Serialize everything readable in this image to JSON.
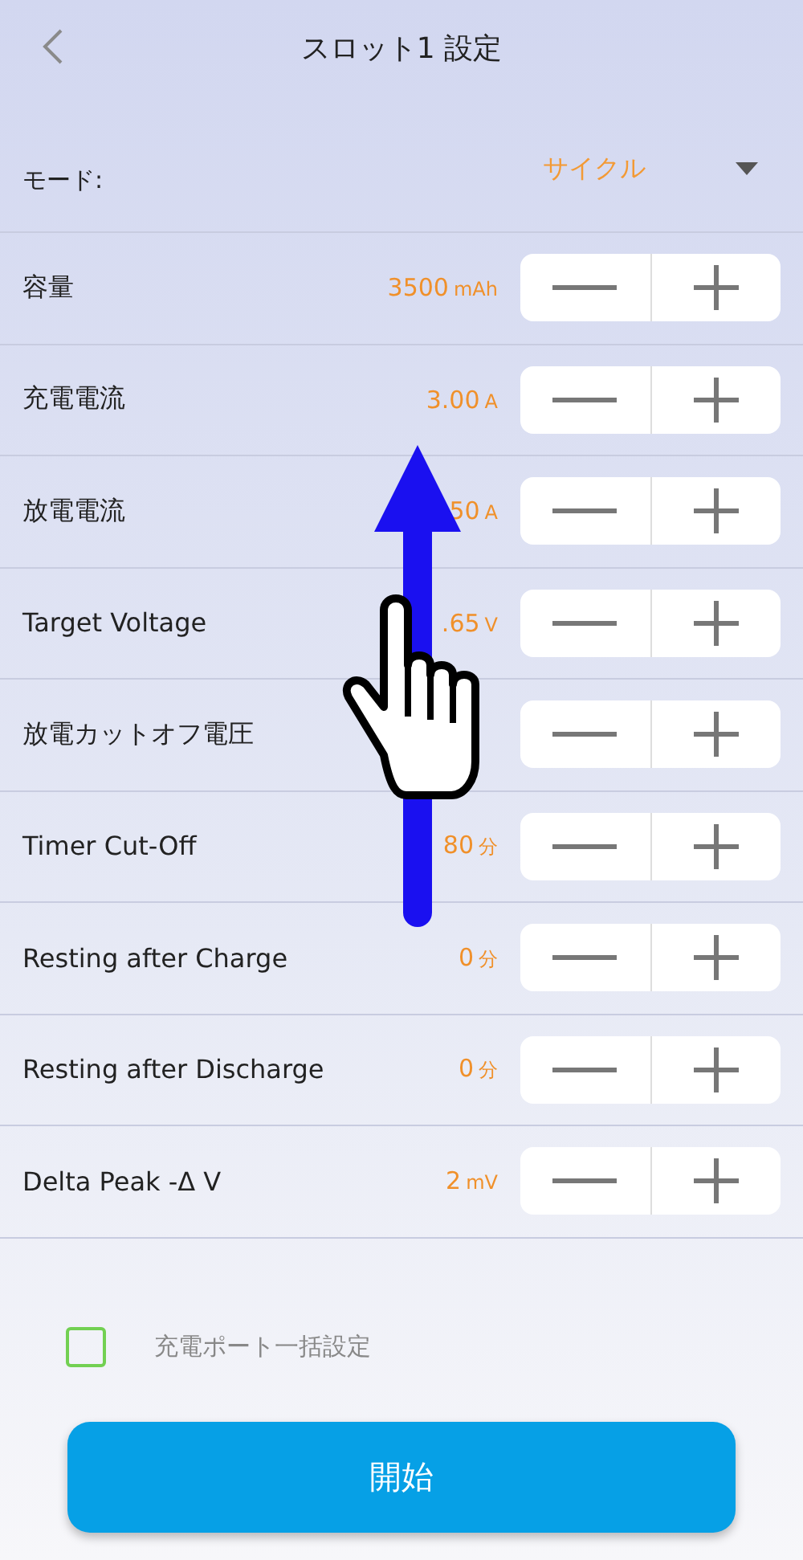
{
  "header": {
    "title": "スロット1 設定"
  },
  "mode": {
    "label": "モード:",
    "value": "サイクル"
  },
  "settings": [
    {
      "label": "容量",
      "value": "3500",
      "unit": "mAh"
    },
    {
      "label": "充電電流",
      "value": "3.00",
      "unit": "A"
    },
    {
      "label": "放電電流",
      "value": "50",
      "unit": "A"
    },
    {
      "label": "Target Voltage",
      "value": ".65",
      "unit": "V"
    },
    {
      "label": "放電カットオフ電圧"
    },
    {
      "label": "Timer Cut-Off",
      "value": "80",
      "unit": "分"
    },
    {
      "label": "Resting after Charge",
      "value": "0",
      "unit": "分"
    },
    {
      "label": "Resting after Discharge",
      "value": "0",
      "unit": "分"
    },
    {
      "label": "Delta Peak -Δ V",
      "value": "2",
      "unit": "mV"
    }
  ],
  "bulk_setting": {
    "label": "充電ポート一括設定",
    "checked": false
  },
  "start_button": {
    "label": "開始"
  }
}
